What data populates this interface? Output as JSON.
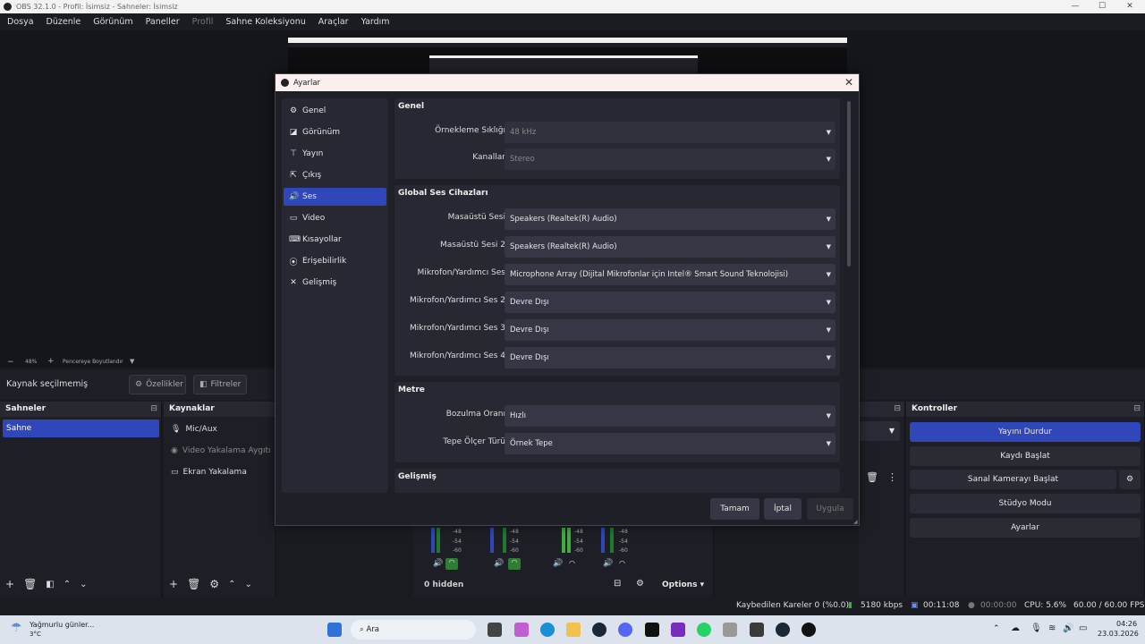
{
  "window": {
    "title": "OBS 32.1.0 - Profil: İsimsiz - Sahneler: İsimsiz",
    "minimize": "—",
    "maximize": "☐",
    "close": "✕"
  },
  "menu": [
    "Dosya",
    "Düzenle",
    "Görünüm",
    "Paneller",
    "Profil",
    "Sahne Koleksiyonu",
    "Araçlar",
    "Yardım"
  ],
  "preview": {
    "zoom": "48%",
    "fit_label": "Pencereye Boyutlandır"
  },
  "source_bar": {
    "status": "Kaynak seçilmemiş",
    "properties": "Özellikler",
    "filters": "Filtreler"
  },
  "scenes": {
    "title": "Sahneler",
    "items": [
      "Sahne"
    ]
  },
  "sources": {
    "title": "Kaynaklar",
    "items": [
      {
        "label": "Mic/Aux",
        "icon": "microphone-icon",
        "dim": false
      },
      {
        "label": "Video Yakalama Aygıtı",
        "icon": "camera-icon",
        "dim": true
      },
      {
        "label": "Ekran Yakalama",
        "icon": "monitor-icon",
        "dim": false
      }
    ]
  },
  "mixer": {
    "hidden": "0 hidden",
    "options": "Options",
    "ticks": [
      "-48",
      "-54",
      "-60"
    ]
  },
  "controls": {
    "title": "Kontroller",
    "stop_stream": "Yayını Durdur",
    "start_record": "Kaydı Başlat",
    "virtual_cam": "Sanal Kamerayı Başlat",
    "studio_mode": "Stüdyo Modu",
    "settings": "Ayarlar"
  },
  "status": {
    "dropped": "Kaybedilen Kareler 0 (%0.0)",
    "bitrate": "5180 kbps",
    "stream_time": "00:11:08",
    "rec_time": "00:00:00",
    "cpu": "CPU: 5.6%",
    "fps": "60.00 / 60.00 FPS"
  },
  "taskbar": {
    "weather": "Yağmurlu günler...",
    "temp": "3°C",
    "search": "Ara",
    "time": "04:26",
    "date": "23.03.2026"
  },
  "dialog": {
    "title": "Ayarlar",
    "nav": [
      {
        "label": "Genel",
        "icon": "gear-icon"
      },
      {
        "label": "Görünüm",
        "icon": "appearance-icon"
      },
      {
        "label": "Yayın",
        "icon": "broadcast-icon"
      },
      {
        "label": "Çıkış",
        "icon": "output-icon"
      },
      {
        "label": "Ses",
        "icon": "speaker-icon"
      },
      {
        "label": "Video",
        "icon": "monitor-icon"
      },
      {
        "label": "Kısayollar",
        "icon": "keyboard-icon"
      },
      {
        "label": "Erişebilirlik",
        "icon": "accessibility-icon"
      },
      {
        "label": "Gelişmiş",
        "icon": "tools-icon"
      }
    ],
    "selected_nav": "Ses",
    "genel": {
      "title": "Genel",
      "rows": [
        {
          "label": "Örnekleme Sıklığı",
          "value": "48 kHz"
        },
        {
          "label": "Kanallar",
          "value": "Stereo"
        }
      ]
    },
    "global": {
      "title": "Global Ses Cihazları",
      "rows": [
        {
          "label": "Masaüstü Sesi",
          "value": "Speakers (Realtek(R) Audio)"
        },
        {
          "label": "Masaüstü Sesi 2",
          "value": "Speakers (Realtek(R) Audio)"
        },
        {
          "label": "Mikrofon/Yardımcı Ses",
          "value": "Microphone Array (Dijital Mikrofonlar için Intel® Smart Sound Teknolojisi)"
        },
        {
          "label": "Mikrofon/Yardımcı Ses 2",
          "value": "Devre Dışı"
        },
        {
          "label": "Mikrofon/Yardımcı Ses 3",
          "value": "Devre Dışı"
        },
        {
          "label": "Mikrofon/Yardımcı Ses 4",
          "value": "Devre Dışı"
        }
      ]
    },
    "metre": {
      "title": "Metre",
      "rows": [
        {
          "label": "Bozulma Oranı",
          "value": "Hızlı"
        },
        {
          "label": "Tepe Ölçer Türü",
          "value": "Örnek Tepe"
        }
      ]
    },
    "advanced": {
      "title": "Gelişmiş"
    },
    "buttons": {
      "ok": "Tamam",
      "cancel": "İptal",
      "apply": "Uygula"
    }
  }
}
